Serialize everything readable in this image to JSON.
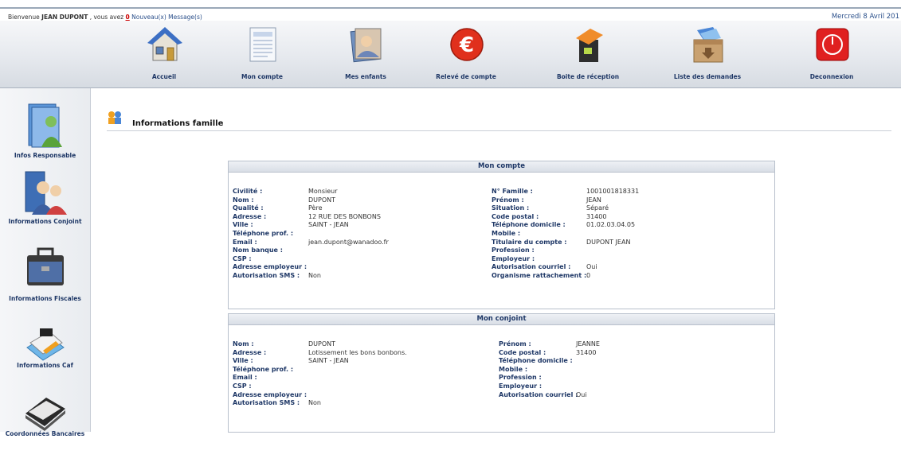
{
  "status": {
    "welcome_prefix": "Bienvenue ",
    "user": "JEAN DUPONT",
    "welcome_suffix": " , vous avez ",
    "message_count": "0",
    "message_text": " Nouveau(x) Message(s)",
    "date": "Mercredi 8 Avril 201"
  },
  "nav": [
    {
      "label": "Accueil",
      "icon": "house-icon"
    },
    {
      "label": "Mon compte",
      "icon": "document-icon"
    },
    {
      "label": "Mes enfants",
      "icon": "photo-icon"
    },
    {
      "label": "Relevé de compte",
      "icon": "euro-icon"
    },
    {
      "label": "Boite de réception",
      "icon": "mailbox-icon"
    },
    {
      "label": "Liste des demandes",
      "icon": "box-icon"
    },
    {
      "label": "Deconnexion",
      "icon": "power-icon"
    }
  ],
  "sidebar": [
    {
      "label": "Infos Responsable",
      "icon": "person-icon"
    },
    {
      "label": "Informations Conjoint",
      "icon": "couple-icon"
    },
    {
      "label": "Informations Fiscales",
      "icon": "briefcase-icon"
    },
    {
      "label": "Informations Caf",
      "icon": "papers-icon"
    },
    {
      "label": "Coordonnées Bancaires",
      "icon": "folder-icon"
    }
  ],
  "page": {
    "title": "Informations famille",
    "icon": "family-icon"
  },
  "mon_compte": {
    "title": "Mon compte",
    "left": [
      {
        "k": "Civilité :",
        "v": "Monsieur"
      },
      {
        "k": "Nom :",
        "v": "DUPONT"
      },
      {
        "k": "Qualité :",
        "v": "Père"
      },
      {
        "k": "Adresse :",
        "v": "12 RUE DES BONBONS"
      },
      {
        "k": "Ville :",
        "v": "SAINT - JEAN"
      },
      {
        "k": "Téléphone prof. :",
        "v": ""
      },
      {
        "k": "Email :",
        "v": "jean.dupont@wanadoo.fr"
      },
      {
        "k": "Nom banque :",
        "v": ""
      },
      {
        "k": "CSP :",
        "v": ""
      },
      {
        "k": "Adresse employeur :",
        "v": ""
      },
      {
        "k": "Autorisation SMS :",
        "v": "Non"
      }
    ],
    "right": [
      {
        "k": "N° Famille :",
        "v": "1001001818331"
      },
      {
        "k": "Prénom :",
        "v": "JEAN"
      },
      {
        "k": "Situation :",
        "v": "Séparé"
      },
      {
        "k": "Code postal :",
        "v": "31400"
      },
      {
        "k": "Téléphone domicile :",
        "v": "01.02.03.04.05"
      },
      {
        "k": "Mobile :",
        "v": ""
      },
      {
        "k": "Titulaire du compte :",
        "v": "DUPONT JEAN"
      },
      {
        "k": "Profession :",
        "v": ""
      },
      {
        "k": "Employeur :",
        "v": ""
      },
      {
        "k": "Autorisation courriel :",
        "v": "Oui"
      },
      {
        "k": "Organisme rattachement :",
        "v": "0"
      }
    ]
  },
  "mon_conjoint": {
    "title": "Mon conjoint",
    "left": [
      {
        "k": "Nom :",
        "v": "DUPONT"
      },
      {
        "k": "Adresse :",
        "v": "Lotissement les bons bonbons."
      },
      {
        "k": "Ville :",
        "v": "SAINT - JEAN"
      },
      {
        "k": "Téléphone prof. :",
        "v": ""
      },
      {
        "k": "Email :",
        "v": ""
      },
      {
        "k": "CSP :",
        "v": ""
      },
      {
        "k": "Adresse employeur :",
        "v": ""
      },
      {
        "k": "Autorisation SMS :",
        "v": "Non"
      }
    ],
    "right": [
      {
        "k": "Prénom :",
        "v": "JEANNE"
      },
      {
        "k": "Code postal :",
        "v": "31400"
      },
      {
        "k": "Téléphone domicile :",
        "v": ""
      },
      {
        "k": "Mobile :",
        "v": ""
      },
      {
        "k": "Profession :",
        "v": ""
      },
      {
        "k": "Employeur :",
        "v": ""
      },
      {
        "k": "Autorisation courriel :",
        "v": "Oui"
      }
    ]
  }
}
